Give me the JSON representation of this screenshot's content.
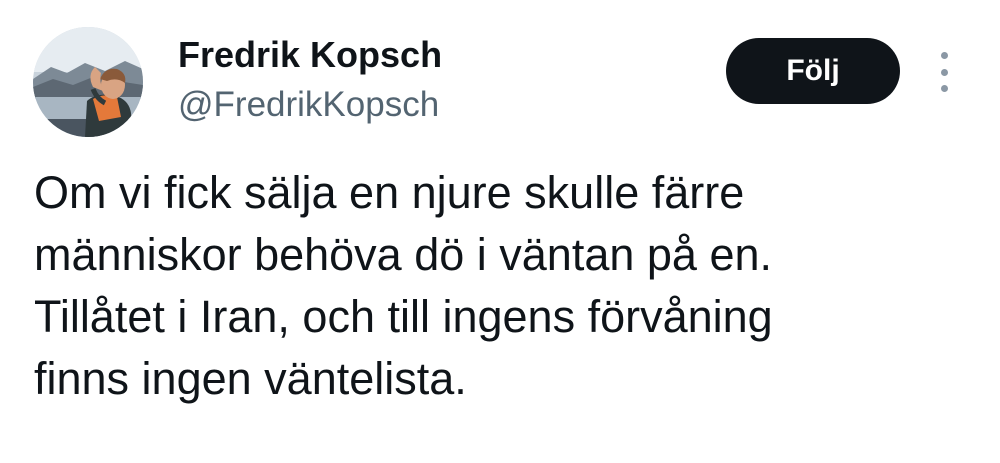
{
  "author": {
    "display_name": "Fredrik Kopsch",
    "handle": "@FredrikKopsch"
  },
  "actions": {
    "follow_label": "Följ",
    "more_icon": "more-vertical-icon"
  },
  "tweet": {
    "lines": [
      "Om vi fick sälja en njure skulle färre",
      "människor behöva dö i väntan på en.",
      "Tillåtet i Iran, och till ingens förvåning",
      "finns ingen väntelista."
    ]
  },
  "colors": {
    "text": "#0f1419",
    "secondary_text": "#536471",
    "button_bg": "#0f1419",
    "button_text": "#ffffff"
  }
}
